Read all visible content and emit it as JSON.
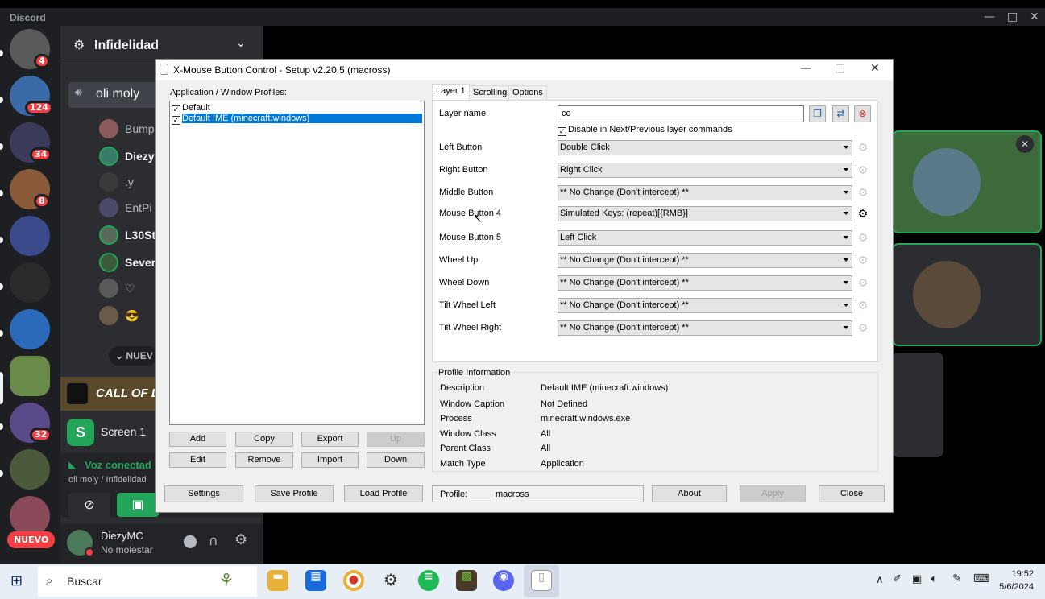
{
  "discord": {
    "app_title": "Discord",
    "server_badges": [
      "4",
      "124",
      "34",
      "8",
      "32"
    ],
    "nuevo": "NUEVO",
    "guild_name": "Infidelidad",
    "voice_channel": "oli moly",
    "members": [
      "Bump",
      "Diezy",
      ".y",
      "EntPi",
      "L30St",
      "Sever",
      "♡",
      "😎"
    ],
    "nuevo_divider": "NUEV",
    "cod_banner": "CALL OF DUTY",
    "screen_label": "Screen 1",
    "voice_connected": "Voz conectad",
    "voice_location": "oli moly / Infidelidad",
    "username": "DiezyMC",
    "status": "No molestar"
  },
  "xmouse": {
    "title": "X-Mouse Button Control - Setup v2.20.5 (macross)",
    "profiles_label": "Application / Window Profiles:",
    "profiles": [
      {
        "label": "Default",
        "checked": true,
        "selected": false
      },
      {
        "label": "Default IME (minecraft.windows)",
        "checked": true,
        "selected": true
      }
    ],
    "list_buttons": [
      "Add",
      "Copy",
      "Export",
      "Up",
      "Edit",
      "Remove",
      "Import",
      "Down"
    ],
    "tabs": [
      "Layer 1",
      "Scrolling",
      "Options"
    ],
    "layer_name_label": "Layer name",
    "layer_name_value": "cc",
    "disable_layer_label": "Disable in Next/Previous layer commands",
    "mappings": [
      {
        "label": "Left Button",
        "value": "Double Click"
      },
      {
        "label": "Right Button",
        "value": "Right Click"
      },
      {
        "label": "Middle Button",
        "value": "** No Change (Don't intercept) **"
      },
      {
        "label": "Mouse Button 4",
        "value": "Simulated Keys: (repeat)[{RMB}]"
      },
      {
        "label": "Mouse Button 5",
        "value": "Left Click"
      },
      {
        "label": "Wheel Up",
        "value": "** No Change (Don't intercept) **"
      },
      {
        "label": "Wheel Down",
        "value": "** No Change (Don't intercept) **"
      },
      {
        "label": "Tilt Wheel Left",
        "value": "** No Change (Don't intercept) **"
      },
      {
        "label": "Tilt Wheel Right",
        "value": "** No Change (Don't intercept) **"
      }
    ],
    "profile_info_label": "Profile Information",
    "profile_info": [
      {
        "k": "Description",
        "v": "Default IME (minecraft.windows)"
      },
      {
        "k": "Window Caption",
        "v": "Not Defined"
      },
      {
        "k": "Process",
        "v": "minecraft.windows.exe"
      },
      {
        "k": "Window Class",
        "v": "All"
      },
      {
        "k": "Parent Class",
        "v": "All"
      },
      {
        "k": "Match Type",
        "v": "Application"
      }
    ],
    "bottom_buttons": {
      "settings": "Settings",
      "save": "Save Profile",
      "load": "Load Profile",
      "about": "About",
      "apply": "Apply",
      "close": "Close"
    },
    "profile_label": "Profile:",
    "profile_value": "macross"
  },
  "taskbar": {
    "search_placeholder": "Buscar",
    "time": "19:52",
    "date": "5/6/2024"
  }
}
